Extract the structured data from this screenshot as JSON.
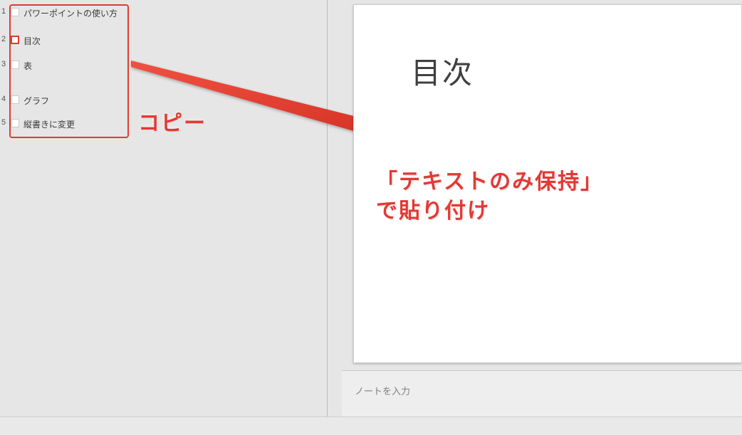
{
  "outline": {
    "items": [
      {
        "num": "1",
        "label": "パワーポイントの使い方"
      },
      {
        "num": "2",
        "label": "目次"
      },
      {
        "num": "3",
        "label": "表"
      },
      {
        "num": "4",
        "label": "グラフ"
      },
      {
        "num": "5",
        "label": "縦書きに変更"
      }
    ],
    "selected_index": 1
  },
  "slide": {
    "title": "目次"
  },
  "notes": {
    "placeholder": "ノートを入力"
  },
  "annotations": {
    "copy": "コピー",
    "paste_line1": "「テキストのみ保持」",
    "paste_line2": "で貼り付け"
  }
}
